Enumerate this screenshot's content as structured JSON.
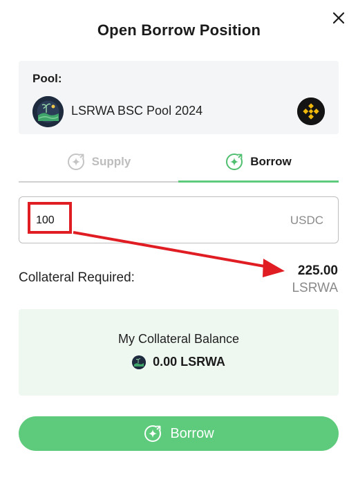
{
  "dialog": {
    "title": "Open Borrow Position"
  },
  "pool": {
    "label": "Pool:",
    "name": "LSRWA BSC Pool 2024",
    "logo_icon": "lsrwa-landscape-icon",
    "chain_icon": "binance-bnb-icon"
  },
  "tabs": [
    {
      "label": "Supply",
      "icon": "sparkle-arrow-icon",
      "active": false
    },
    {
      "label": "Borrow",
      "icon": "sparkle-arrow-icon",
      "active": true
    }
  ],
  "amount": {
    "value": "100",
    "unit": "USDC"
  },
  "collateral": {
    "label": "Collateral Required:",
    "value": "225.00",
    "unit": "LSRWA"
  },
  "balance": {
    "title": "My Collateral Balance",
    "value": "0.00 LSRWA",
    "icon": "lsrwa-token-icon"
  },
  "borrow_button": {
    "label": "Borrow",
    "icon": "sparkle-arrow-icon"
  },
  "colors": {
    "accent": "#5dcb7b",
    "annotation": "#e11d24",
    "balance_bg": "#eef8f1",
    "pool_bg": "#f4f5f6"
  }
}
